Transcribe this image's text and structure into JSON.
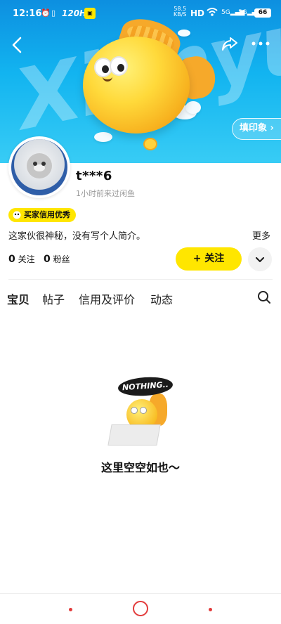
{
  "status_bar": {
    "time": "12:16",
    "refresh_rate": "120Hz",
    "net_speed_value": "58.5",
    "net_speed_unit": "KB/S",
    "hd_label": "HD",
    "signal_1": "5G",
    "signal_2": "5G",
    "battery": "66"
  },
  "hero": {
    "background_text": "Xianyu",
    "pin_button_label": "填印象 ›"
  },
  "profile": {
    "username": "t***6",
    "last_seen": "1小时前来过闲鱼",
    "credit_badge": "买家信用优秀",
    "bio": "这家伙很神秘，没有写个人简介。",
    "more_label": "更多",
    "following_count": "0",
    "following_label": "关注",
    "followers_count": "0",
    "followers_label": "粉丝",
    "follow_button": "+ 关注"
  },
  "tabs": [
    {
      "label": "宝贝",
      "active": true
    },
    {
      "label": "帖子",
      "active": false
    },
    {
      "label": "信用及评价",
      "active": false
    },
    {
      "label": "动态",
      "active": false
    }
  ],
  "empty_state": {
    "bubble_text": "NOTHING..",
    "message": "这里空空如也～"
  },
  "colors": {
    "accent_yellow": "#ffe600",
    "hero_blue": "#12b4f0",
    "nav_red": "#e23b3b"
  },
  "icons": {
    "back": "chevron-left-icon",
    "share": "share-icon",
    "more": "more-dots-icon",
    "search": "search-icon",
    "dropdown": "chevron-down-icon"
  }
}
